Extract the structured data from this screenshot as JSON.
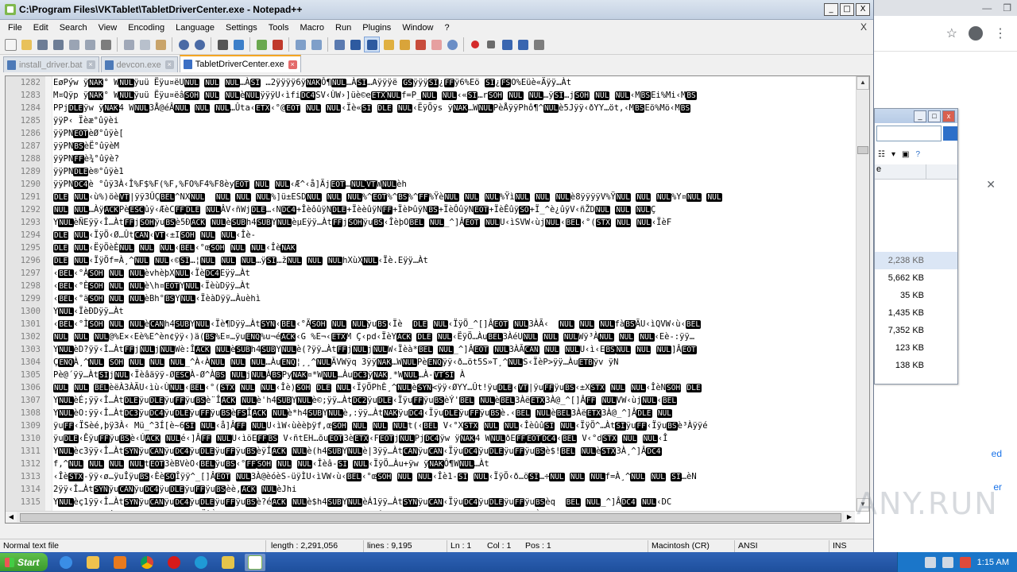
{
  "window": {
    "title": "C:\\Program Files\\VKTablet\\TabletDriverCenter.exe - Notepad++",
    "minimize_glyph": "_",
    "maximize_glyph": "□",
    "close_glyph": "X"
  },
  "menu": {
    "items": [
      "File",
      "Edit",
      "Search",
      "View",
      "Encoding",
      "Language",
      "Settings",
      "Tools",
      "Macro",
      "Run",
      "Plugins",
      "Window",
      "?"
    ],
    "close_doc_glyph": "X"
  },
  "tabs": [
    {
      "label": "install_driver.bat",
      "active": false
    },
    {
      "label": "devcon.exe",
      "active": false
    },
    {
      "label": "TabletDriverCenter.exe",
      "active": true
    }
  ],
  "editor": {
    "lines": [
      {
        "n": "1282",
        "t": "EøPýw ÿNAK° WNULÿuü Ëÿu¤ëUNUL NUL NUL…ÀSI …2ÿÿÿÿ6ÿNAKÔ¶NUL…ÀSI…Aÿÿÿë GSÿÿÿSI¿FFÿ6%Eö SI¿FSO%Eüè«Äÿÿ…Àt"
      },
      {
        "n": "1283",
        "t": "M¤Qÿp ÿNAK° WNULÿuü Ëÿu¤ëâSOH NUL NULèNULÿÿÿU‹ìfiDC4SV‹ÙW›]üè©eETXNULf=P_NUL NUL‹«SI…rSOH NUL NUL…ÿSI…jSOH NUL NUL‹MBSEi%Mi‹MBS"
      },
      {
        "n": "1284",
        "t": "PPjDLEÿw ÿNAK4 WNUL3Å@éÂNUL NUL NUL…Ûta‹ETX‹°@EOT NUL NUL‹Ïè«SI DLE NUL‹ËÿÕÿs ÿNAK…WNULPèÅÿÿPhô¶^NULè5Jÿÿ‹ðYY…öt,‹MBSEö%Mö‹MBS"
      },
      {
        "n": "1285",
        "t": "ÿÿP‹ Ïèæ°ûÿèi"
      },
      {
        "n": "1286",
        "t": "ÿÿPNEOTèØ°ûÿè["
      },
      {
        "n": "1287",
        "t": "ÿÿPNBSèË°ûÿèM"
      },
      {
        "n": "1288",
        "t": "ÿÿPNFFè¾°ûÿè?"
      },
      {
        "n": "1289",
        "t": "ÿÿPNDLEè®°ûÿè1"
      },
      {
        "n": "1290",
        "t": "ÿÿPNDC4è °ûÿ3À‹Î%F$%F(%F,%FO%F4%F8èyEOT NUL NUL‹Æ^‹å]ÃjEOT…NULVTWNULèh"
      },
      {
        "n": "1291",
        "t": "DLE NUL‹ù%)öèVT|ÿÿ3ÛÇBEL^NXNUL  NUL NUL NUL%]ü±ESDNUL NUL NUL%^EOT%^BS%^FF%ŸèNUL NUL NUL%ŸìNUL NUL NULè8ÿÿÿÿV%ŸNUL NUL NUL%Y¤NUL NUL"
      },
      {
        "n": "1292",
        "t": "NUL NUL…ÀÿACKPèESCûÿ‹ÆèCFFDLE NULÂV‹ñWjDLE…‹NDC4+ÎèôûÿNDLE+ÏèèûÿNFF+ÏèÞûÿNBS+ÏèÔûÿNEOT+ÏèÊûÿSO+Ï_^è¿ûÿV‹ñŽDNUL NUL NULÇ"
      },
      {
        "n": "1293",
        "t": "YNULèÑEÿÿ‹Î…ÀtFFjSOHÿuBSè5ÐACK NULèSUBh4SUBYNULèµEÿÿ…ÀtFFjSOHÿuBS‹ÎèþOBEL NUL_^]ÂEOT NULU‹ìSVW‹ùjNUL‹BEL‹°(STX NUL NUL‹ÏèF"
      },
      {
        "n": "1294",
        "t": "DLE NUL‹ÏÿÖ‹Ø…ÛtCAN‹VT‹±ISOH NUL NUL‹Îè-"
      },
      {
        "n": "1295",
        "t": "DLE NUL‹ËÿÖèÈNUL NUL NUL‹BEL‹°œSOH NUL NUL‹ÎèNAK"
      },
      {
        "n": "1296",
        "t": "DLE NUL‹ÏÿÖf=À¸^NUL NUL‹©SI…¦NUL NUL NUL…ÿSI…žNUL NUL NULhXùXNUL‹Ïè.Eÿÿ…Àt"
      },
      {
        "n": "1297",
        "t": "‹BEL‹°ÀSOH NUL NULèvhèþXNUL‹ÏèDC4Eÿÿ…Àt"
      },
      {
        "n": "1298",
        "t": "‹BEL‹°ÈSOH NUL NULè\\h¤EOTYNUL‹ÏèùDÿÿ…Àt"
      },
      {
        "n": "1299",
        "t": "‹BEL‹°äSOH NUL NULèBh°BSYNUL‹ÏèàDÿÿ…Àuèhì"
      },
      {
        "n": "1300",
        "t": "YNUL‹ÏèÐDÿÿ…Àt"
      },
      {
        "n": "1301",
        "t": "‹BEL‹°ÌSOH NUL NULèCANh4SUBYNUL‹Ïè¶Dÿÿ…ÀtSYN‹BEL‹°ÄSOH NUL NULÿuBS‹Ïè  DLE NUL‹ÏÿÖ_^[]ÂEOT NUL3ÀÃ‹  NUL NUL NULfàBSÃU‹ìQVW‹ù‹BEL"
      },
      {
        "n": "1302",
        "t": "NUL NUL NUL@%E×‹Eè%E^èn¢ÿÿ‹)ä(BS%E¤…ÿuENQ%u¬éACK‹G %E¬‹ETXM Ç‹pd‹ÏèYACK DLE NUL‹ËÿÖ…ÀuBEL3ÀéUNUL NUL NULWÿ³ÀNUL NUL NUL‹Eè-:ÿÿ…"
      },
      {
        "n": "1303",
        "t": "YNULèD?ÿÿ‹Î…ÀtFFjNULjNULWè:ÎACK NULèSUBh4SUBYNULè(?ÿÿ…ÀtFFjNULjNULW‹Ïèà*BEL NUL_^]ÂEOT NUL3ÀÃCAN NUL NULU‹ì‹EBSNUL NUL NUL]ÂEOT"
      },
      {
        "n": "1304",
        "t": "ÇENQÀ¸^NUL SOH NUL NUL NUL_^À‹ÀNUL NUL NUL…ÀuENQ¦¸¸^NULÄVWÿq 3ÿÿNAK…WNULPèENQÿÿ‹ð…öt5S»T¸^NULS‹ÏèP>ÿÿ…ÀuETBÿv ÿN"
      },
      {
        "n": "1305",
        "t": "Pè@´ÿÿ…ÀtSIjNUL‹Ïèâäÿÿ-ØESCÀ-Ø^ÀBS NULjNULÀBSPyNAK¤*WNUL…ÀuDC3ÿNAK¸*WNUL…À-VTSI À"
      },
      {
        "n": "1306",
        "t": "NUL NUL BELèëÀ3ÀÃU‹ìù‹ÙNUL‹BEL‹°(STX NUL NUL‹Îè)SOH DLE NUL‹ÏÿÖPhÈ¸^NULèSYN<ÿÿ‹ØYY…Ût!ÿuDLE‹VT|ÿuFFÿuBS‹±XSTX NUL NUL‹ÎèNSOH DLE"
      },
      {
        "n": "1307",
        "t": "YNULèÉ;ÿÿ‹Î…ÀtDLEÿuDLEÿuFFÿuBSè¨ÎACK NULè'h4SUBYNULè©;ÿÿ…ÀtDC2ÿuDLE‹ÏÿuFFÿuBSèÝ'BEL NULèBEL3ÀëETX3À@_^[]ÂFF NULVW‹ùjNUL‹BEL"
      },
      {
        "n": "1308",
        "t": "YNULèO:ÿÿ‹Î…ÀtDC3ÿuDC4ÿuDLEÿuFFÿuBSèFSÎACK NULè*h4SUBYNULè,:ÿÿ…ÀtNAKÿuDC4‹ÏÿuDLEÿuFFÿuBSè.‹BEL NULèBEL3ÀëETX3À@_^]ÂDLE NUL"
      },
      {
        "n": "1309",
        "t": "ÿuFF‹ÏSèé,þÿ3À‹ Mü_^3Í[è~6SI NUL‹å]ÂFF NULU‹ìW‹ùèèþÿf,œSOH NUL NUL NULt(‹BEL V‹°XSTX NUL NUL‹ÎèûûSI NUL‹ÏÿÖ^…ÀtSIÿuFF‹ÏÿuBSè³Àÿÿé"
      },
      {
        "n": "1310",
        "t": "ÿuDLE‹ÊÿuFFÿuBSè‹ÚACK NULé‹]ÂFF NULU‹ìöEFFBS V‹ñtEH…õuEOT3èETX‹FEOTjNULPjDC4ÿw ÿNAK4 WNULðEFFEOTDC4‹BEL V‹°dSTX NUL NUL‹Î"
      },
      {
        "n": "1311",
        "t": "YNULèc3ÿÿ‹Î…ÀtSYNÿuCANÿuDC4ÿuDLEÿuFFÿuBSèÿÍACK NULè(h4SUBYNULè|3ÿÿ…ÀtCANÿuCAN‹ÏÿuDC4ÿuDLEÿuFFÿuBSè$!BEL NULèSTX3À¸^]ÂDC4"
      },
      {
        "n": "1312",
        "t": "f‚^NUL NUL NUL NULtEOT3èBVèO‹BELÿuBS‹°FFSOH NUL NUL‹Îèâ-SI NUL‹ÏÿÖ…Àu+ÿw ÿNAKÔ¶WNUL…Àt"
      },
      {
        "n": "1313",
        "t": "‹ÎèSTX-ÿÿ‹ø…ÿuÎÿuBS‹ÈèSOÎÿÿ^_[]ÂEOT NUL3À@èóèS-üÿÌU‹ìVW‹ù‹BEL‹°œSOH NUL NUL‹Îè1-SI NUL‹ÏÿÖ‹ð…öSI…÷NUL NUL NULf=À¸^NUL NUL SI…èN"
      },
      {
        "n": "1314",
        "t": "2ÿÿ‹Î…ÀtSYNÿuCANÿuDC4ÿuDLEÿuFFÿuBSèè‚ACK NULèJhi"
      },
      {
        "n": "1315",
        "t": "YNULèç1ÿÿ‹Î…ÀtSYNÿuCANÿuDC4ÿuDLEÿuFFÿuBSè?éACK NULè$h4SUBYNULèÁ1ÿÿ…ÀtSYNÿuCAN‹ÏÿuDC4ÿuDLEÿuFFÿuBSèq  BEL NUL_^]ÂDC4 NUL‹DC"
      },
      {
        "n": "1316",
        "t": "§ÿÿf)FFNUL‹ôtACKf)BS NULuBSS‹ÏèÙTÿÿjNULjNULÿ5h_NULÿv ÿNAKFS WNULè~SOH NUL NUL‹#¸NUL NUL NUL%Eu…Àt!ÿuDLE‹NULÿuFFÿuBS‹° STX NUL"
      }
    ]
  },
  "status": {
    "file_type": "Normal text file",
    "length": "length : 2,291,056",
    "lines": "lines : 9,195",
    "ln": "Ln : 1",
    "col": "Col : 1",
    "pos": "Pos : 1",
    "eol": "Macintosh (CR)",
    "encoding": "ANSI",
    "mode": "INS"
  },
  "background_explorer": {
    "column_header": "e",
    "sizes": [
      "2,238 KB",
      "5,662 KB",
      "35 KB",
      "1,435 KB",
      "7,352 KB",
      "123 KB",
      "138 KB"
    ],
    "selected_index": 0
  },
  "background_browser": {
    "link_text_1": "ed",
    "link_text_2": "er"
  },
  "taskbar": {
    "start_label": "Start",
    "clock": "1:15 AM"
  },
  "watermark": "ANY.RUN",
  "colors": {
    "control_chip_bg": "#000000",
    "control_chip_fg": "#ffffff",
    "title_bar": "#c2d0e2",
    "active_tab_accent": "#f5a623",
    "taskbar": "#1e4f9c"
  }
}
